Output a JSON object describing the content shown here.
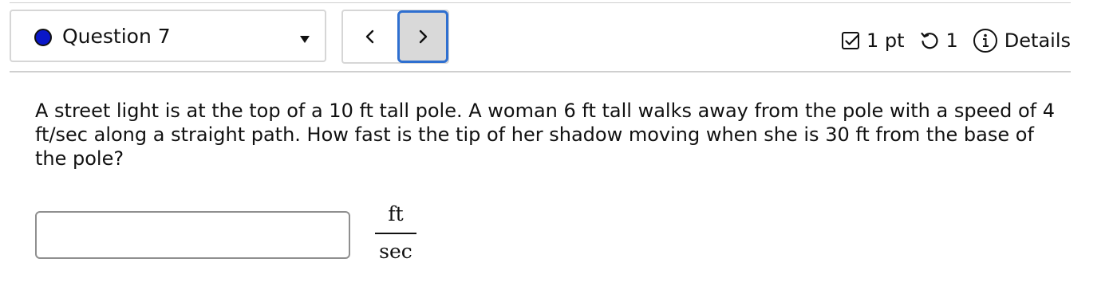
{
  "question_nav": {
    "status_color": "#0a17c9",
    "current_question": "Question 7",
    "prev_icon": "chevron-left-icon",
    "next_icon": "chevron-right-icon"
  },
  "meta": {
    "points_icon": "checkbox-icon",
    "points": "1 pt",
    "attempts_icon": "retry-icon",
    "attempts": "1",
    "details_icon": "info-icon",
    "details_label": "Details"
  },
  "question": {
    "text": "A street light is at the top of a 10 ft tall pole. A woman 6 ft tall walks away from the pole with a speed of 4 ft/sec along a straight path. How fast is the tip of her shadow moving when she is 30 ft from the base of the pole?"
  },
  "answer": {
    "value": "",
    "unit_numerator": "ft",
    "unit_denominator": "sec"
  },
  "colors": {
    "accent_focus": "#2e6fd0",
    "border": "#d6d6d6"
  }
}
